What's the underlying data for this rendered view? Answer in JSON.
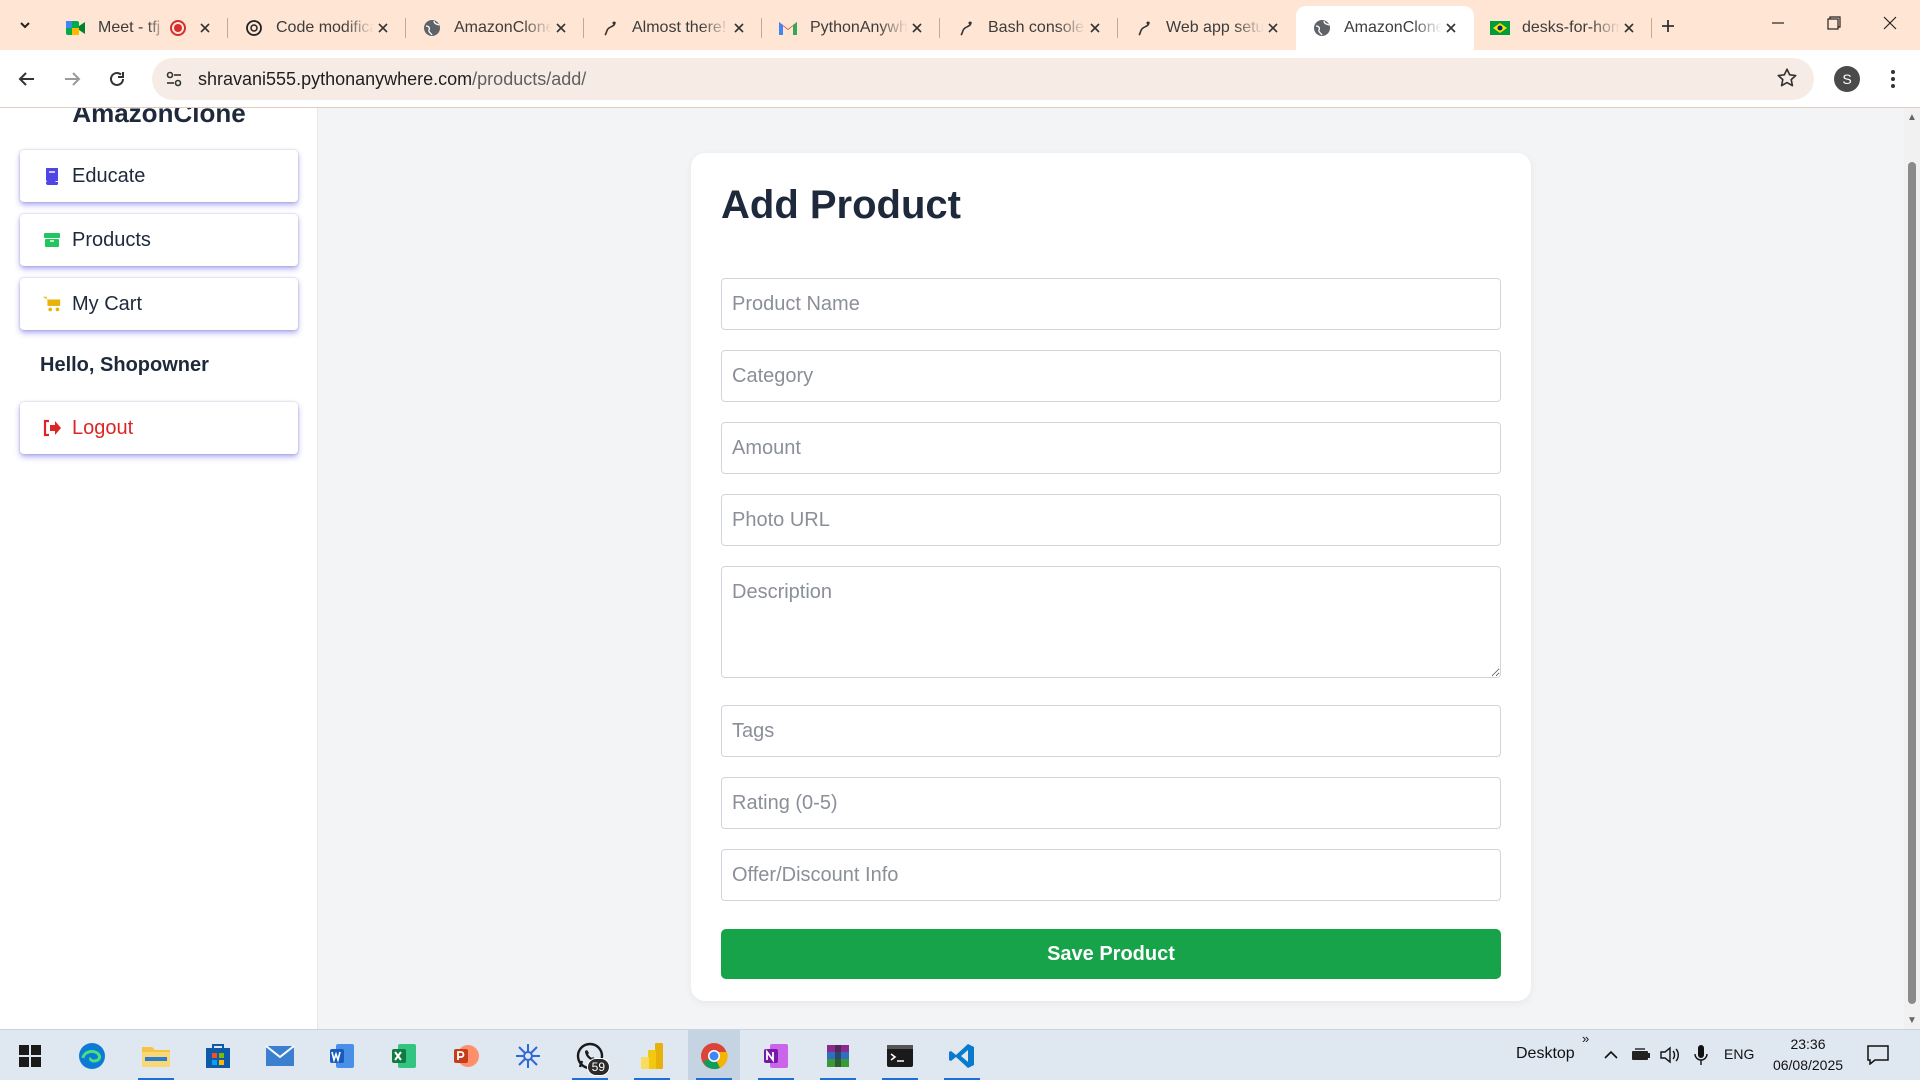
{
  "browser": {
    "tabs": [
      {
        "title": "Meet - tfj",
        "favicon": "google-meet-icon",
        "recording": true
      },
      {
        "title": "Code modification",
        "favicon": "chatgpt-icon"
      },
      {
        "title": "AmazonClone",
        "favicon": "globe-icon"
      },
      {
        "title": "Almost there!",
        "favicon": "pythonanywhere-icon"
      },
      {
        "title": "PythonAnywhere",
        "favicon": "gmail-icon"
      },
      {
        "title": "Bash console",
        "favicon": "pythonanywhere-icon"
      },
      {
        "title": "Web app setup",
        "favicon": "pythonanywhere-icon"
      },
      {
        "title": "AmazonClone",
        "favicon": "globe-icon",
        "active": true
      },
      {
        "title": "desks-for-home",
        "favicon": "flag-icon"
      }
    ],
    "url_host": "shravani555.pythonanywhere.com",
    "url_path": "/products/add/",
    "profile_initial": "S"
  },
  "sidebar": {
    "brand": "AmazonClone",
    "items": [
      {
        "label": "Educate",
        "icon": "book-icon"
      },
      {
        "label": "Products",
        "icon": "box-icon"
      },
      {
        "label": "My Cart",
        "icon": "cart-icon"
      }
    ],
    "greeting": "Hello, Shopowner",
    "logout_label": "Logout"
  },
  "form": {
    "title": "Add Product",
    "fields": {
      "name": "Product Name",
      "category": "Category",
      "amount": "Amount",
      "photo": "Photo URL",
      "description": "Description",
      "tags": "Tags",
      "rating": "Rating (0-5)",
      "offer": "Offer/Discount Info"
    },
    "submit_label": "Save Product"
  },
  "taskbar": {
    "whatsapp_badge": "59",
    "desktop_label": "Desktop",
    "language": "ENG",
    "time": "23:36",
    "date": "06/08/2025"
  },
  "colors": {
    "accent_green": "#16a34a",
    "tab_strip": "#ffe5d4",
    "logout_red": "#dc2626"
  }
}
